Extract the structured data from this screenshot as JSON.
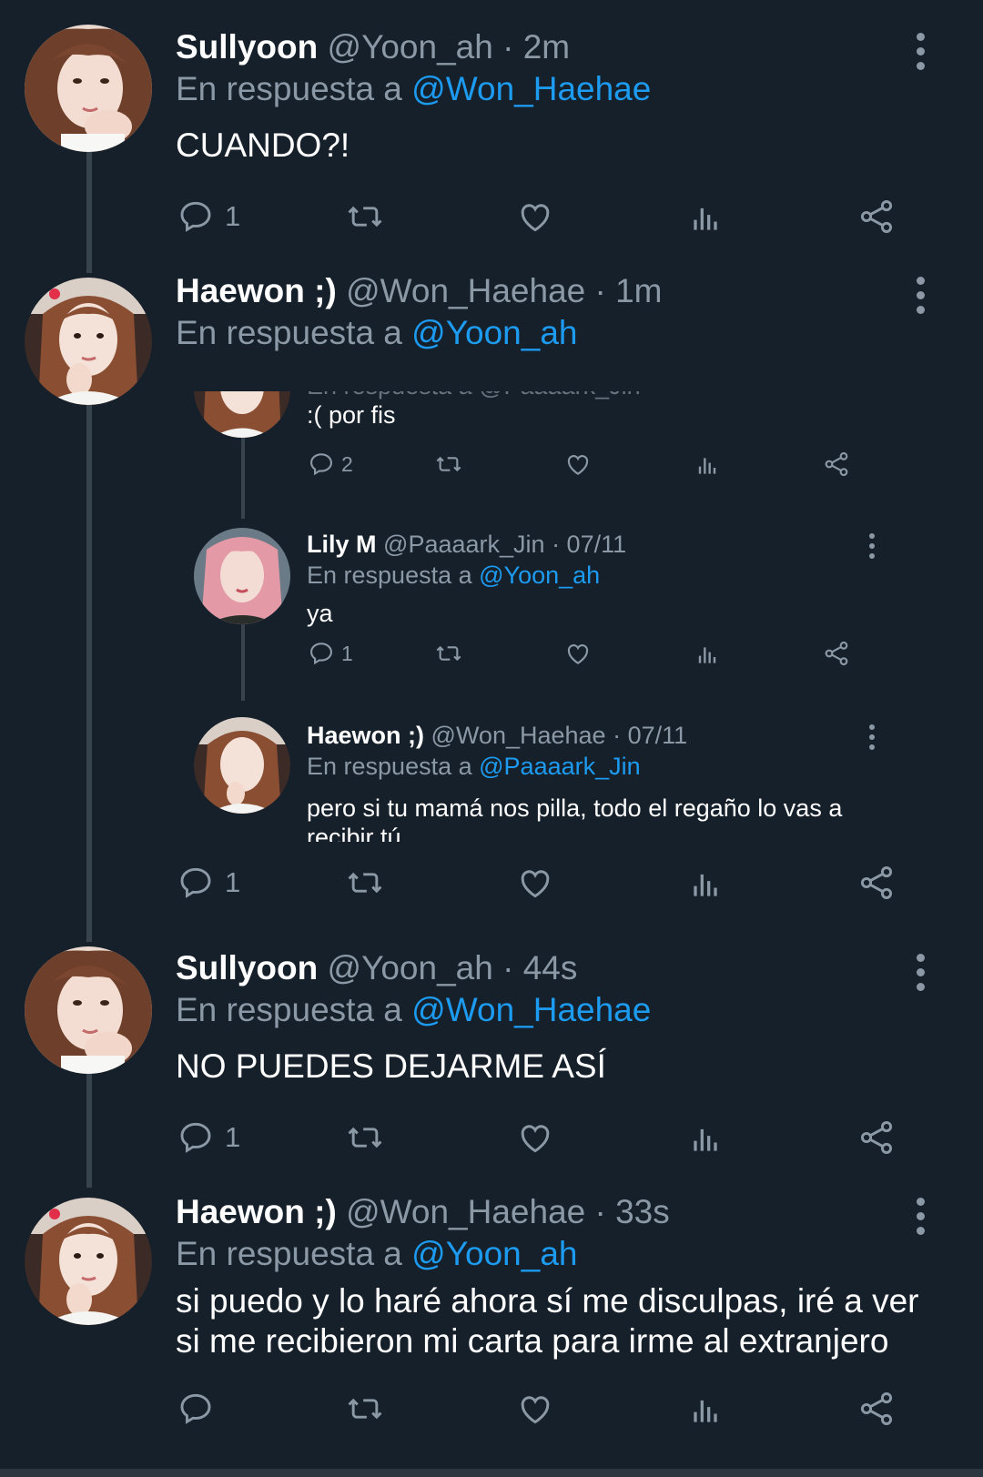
{
  "reply_prefix": "En respuesta a",
  "tweets": [
    {
      "name": "Sullyoon",
      "handle": "@Yoon_ah",
      "time": "· 2m",
      "reply_to": "@Won_Haehae",
      "text": "CUANDO?!",
      "replies": "1"
    },
    {
      "name": "Haewon ;)",
      "handle": "@Won_Haehae",
      "time": "· 1m",
      "reply_to": "@Yoon_ah",
      "text": "",
      "replies": "1"
    },
    {
      "name": "Sullyoon",
      "handle": "@Yoon_ah",
      "time": "· 44s",
      "reply_to": "@Won_Haehae",
      "text": "NO PUEDES DEJARME ASÍ",
      "replies": "1"
    },
    {
      "name": "Haewon ;)",
      "handle": "@Won_Haehae",
      "time": "· 33s",
      "reply_to": "@Yoon_ah",
      "text": "si puedo y lo haré ahora sí me disculpas, iré a ver si me recibieron mi carta para irme al extranjero",
      "replies": ""
    }
  ],
  "embed": {
    "cut_reply": "En respuesta a @Paaaark_Jin",
    "tweets": [
      {
        "name": "",
        "handle": "",
        "time": "",
        "reply_to": "",
        "text": ":( por fis",
        "replies": "2"
      },
      {
        "name": "Lily M",
        "handle": "@Paaaark_Jin",
        "time": "· 07/11",
        "reply_to": "@Yoon_ah",
        "text": "ya",
        "replies": "1"
      },
      {
        "name": "Haewon ;)",
        "handle": "@Won_Haehae",
        "time": "· 07/11",
        "reply_to": "@Paaaark_Jin",
        "text": "pero si tu mamá nos pilla, todo el regaño lo vas a recibir tú",
        "replies": ""
      }
    ]
  },
  "icons": {
    "reply": "speech-bubble-icon",
    "retweet": "retweet-icon",
    "like": "heart-icon",
    "views": "bar-chart-icon",
    "share": "share-icon",
    "more": "more-vertical-icon"
  },
  "colors": {
    "background": "#15202b",
    "secondary_text": "#8b98a5",
    "mention": "#1d9bf0",
    "thread_line": "#38444d"
  }
}
